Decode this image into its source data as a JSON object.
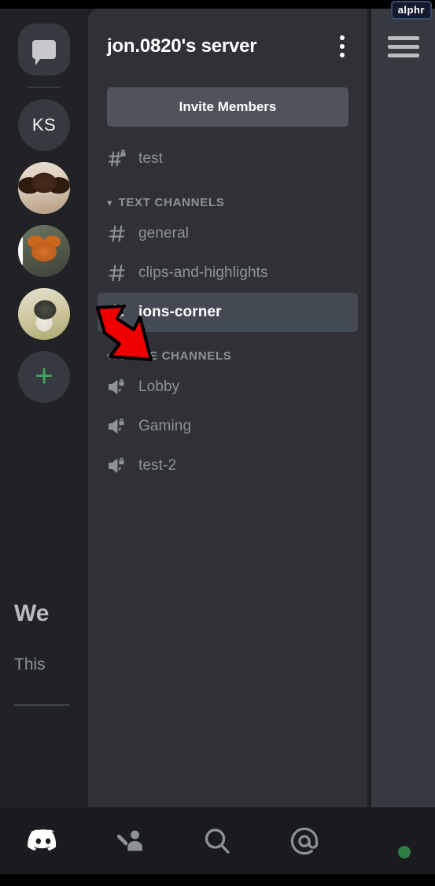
{
  "watermark": {
    "label": "alphr"
  },
  "server_rail": {
    "items": [
      {
        "name": "direct-messages",
        "type": "dm",
        "label": "",
        "selected": false
      },
      {
        "name": "server-ks",
        "type": "initials",
        "label": "KS",
        "selected": false
      },
      {
        "name": "server-dog-1",
        "type": "image",
        "label": "",
        "selected": false
      },
      {
        "name": "server-cat",
        "type": "image",
        "label": "",
        "selected": true
      },
      {
        "name": "server-dog-2",
        "type": "image",
        "label": "",
        "selected": false
      },
      {
        "name": "add-server",
        "type": "plus",
        "label": "+",
        "selected": false
      }
    ]
  },
  "panel": {
    "server_title": "jon.0820's server",
    "more_options_label": "",
    "invite_button": "Invite Members",
    "top_channels": [
      {
        "label": "test",
        "icon": "hash-lock-icon",
        "type": "text",
        "private": true,
        "active": false
      }
    ],
    "sections": [
      {
        "title": "TEXT CHANNELS",
        "collapsed": false,
        "channels": [
          {
            "label": "general",
            "icon": "hash-icon",
            "type": "text",
            "private": false,
            "active": false
          },
          {
            "label": "clips-and-highlights",
            "icon": "hash-icon",
            "type": "text",
            "private": false,
            "active": false
          },
          {
            "label": "jons-corner",
            "icon": "hash-icon",
            "type": "text",
            "private": false,
            "active": true
          }
        ]
      },
      {
        "title": "VOICE CHANNELS",
        "collapsed": false,
        "channels": [
          {
            "label": "Lobby",
            "icon": "speaker-lock-icon",
            "type": "voice",
            "private": true,
            "active": false
          },
          {
            "label": "Gaming",
            "icon": "speaker-lock-icon",
            "type": "voice",
            "private": true,
            "active": false
          },
          {
            "label": "test-2",
            "icon": "speaker-lock-icon",
            "type": "voice",
            "private": true,
            "active": false
          }
        ]
      }
    ]
  },
  "chat_peek": {
    "menu_icon": "hamburger-icon",
    "welcome_heading": "We",
    "welcome_body": "This"
  },
  "bottom_nav": {
    "items": [
      {
        "name": "nav-servers",
        "icon": "discord-logo-icon",
        "active": true
      },
      {
        "name": "nav-friends",
        "icon": "friends-icon",
        "active": false
      },
      {
        "name": "nav-search",
        "icon": "search-icon",
        "active": false
      },
      {
        "name": "nav-mentions",
        "icon": "mention-icon",
        "active": false
      },
      {
        "name": "nav-profile",
        "icon": "user-avatar",
        "active": false
      }
    ]
  },
  "annotation": {
    "type": "red-arrow",
    "points_to": "jons-corner",
    "fill": "#ee0000",
    "stroke": "#000000"
  },
  "colors": {
    "rail_bg": "#202225",
    "panel_bg": "#2f3136",
    "chat_bg": "#36393f",
    "bottom_bg": "#1a1b1e",
    "active_channel_bg": "#434a54",
    "invite_btn_bg": "#4f545c",
    "muted_text": "#8e9297",
    "accent_green": "#3ba55d"
  }
}
